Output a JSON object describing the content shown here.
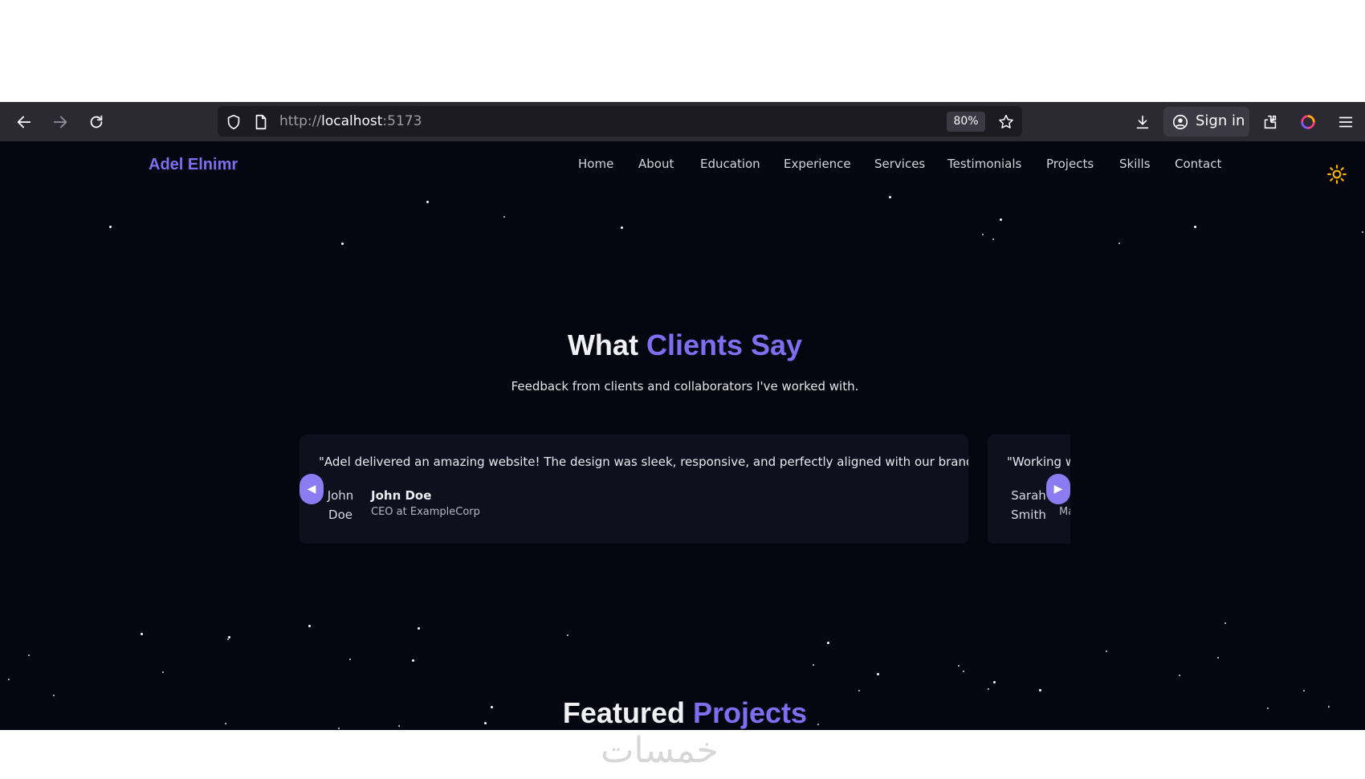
{
  "browser": {
    "url_scheme": "http://",
    "url_host": "localhost",
    "url_port": ":5173",
    "zoom": "80%",
    "sign_in_label": "Sign in"
  },
  "site": {
    "logo": "Adel Elnimr",
    "nav": [
      "Home",
      "About",
      "Education",
      "Experience",
      "Services",
      "Testimonials",
      "Projects",
      "Skills",
      "Contact"
    ]
  },
  "testimonials": {
    "title_prefix": "What",
    "title_accent": "Clients Say",
    "subtitle": "Feedback from clients and collaborators I've worked with.",
    "prev_label": "◀",
    "next_label": "▶",
    "items": [
      {
        "quote": "\"Adel delivered an amazing website! The design was sleek, responsive, and perfectly aligned with our brand.\"",
        "avatar_alt_1": "John",
        "avatar_alt_2": "Doe",
        "name": "John Doe",
        "role": "CEO at ExampleCorp"
      },
      {
        "quote": "\"Working w",
        "avatar_alt_1": "Sarah",
        "avatar_alt_2": "Smith",
        "name": "",
        "role": "Ma"
      }
    ]
  },
  "projects": {
    "title_prefix": "Featured",
    "title_accent": "Projects"
  },
  "watermark": "خمسات",
  "colors": {
    "accent": "#7f6ef0",
    "background": "#05060f",
    "card": "#0e111d",
    "arrow": "#8b7cf2",
    "sun": "#f5b400"
  }
}
